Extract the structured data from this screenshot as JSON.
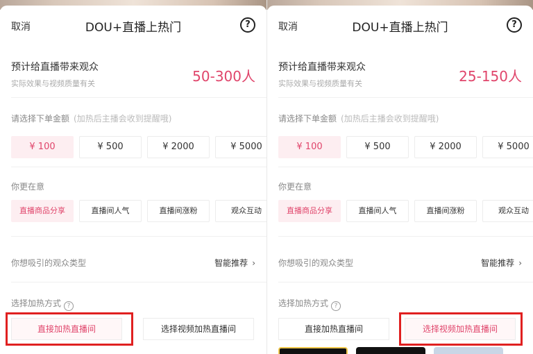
{
  "panels": [
    {
      "header": {
        "cancel": "取消",
        "title": "DOU+直播上热门",
        "help_glyph": "?"
      },
      "estimate": {
        "label": "预计给直播带来观众",
        "sub": "实际效果与视频质量有关",
        "value": "50-300人"
      },
      "amount": {
        "label": "请选择下单金额",
        "hint": "(加热后主播会收到提醒哦)",
        "options": [
          "¥ 100",
          "¥ 500",
          "¥ 2000",
          "¥ 5000"
        ],
        "selected_index": 0
      },
      "care": {
        "label": "你更在意",
        "options": [
          "直播商品分享",
          "直播间人气",
          "直播间涨粉",
          "观众互动"
        ],
        "selected_index": 0
      },
      "audience": {
        "label": "你想吸引的观众类型",
        "value": "智能推荐",
        "chevron": "›"
      },
      "method": {
        "label": "选择加热方式",
        "options": [
          "直接加热直播间",
          "选择视频加热直播间"
        ],
        "selected_index": 0,
        "highlighted_index": 0
      }
    },
    {
      "header": {
        "cancel": "取消",
        "title": "DOU+直播上热门",
        "help_glyph": "?"
      },
      "estimate": {
        "label": "预计给直播带来观众",
        "sub": "实际效果与视频质量有关",
        "value": "25-150人"
      },
      "amount": {
        "label": "请选择下单金额",
        "hint": "(加热后主播会收到提醒哦)",
        "options": [
          "¥ 100",
          "¥ 500",
          "¥ 2000",
          "¥ 5000"
        ],
        "selected_index": 0
      },
      "care": {
        "label": "你更在意",
        "options": [
          "直播商品分享",
          "直播间人气",
          "直播间涨粉",
          "观众互动"
        ],
        "selected_index": 0
      },
      "audience": {
        "label": "你想吸引的观众类型",
        "value": "智能推荐",
        "chevron": "›"
      },
      "method": {
        "label": "选择加热方式",
        "options": [
          "直接加热直播间",
          "选择视频加热直播间"
        ],
        "selected_index": 1,
        "highlighted_index": 1
      }
    }
  ],
  "colors": {
    "accent": "#e0456b",
    "highlight_box": "#e02020",
    "selected_bg": "#fdeef1"
  }
}
